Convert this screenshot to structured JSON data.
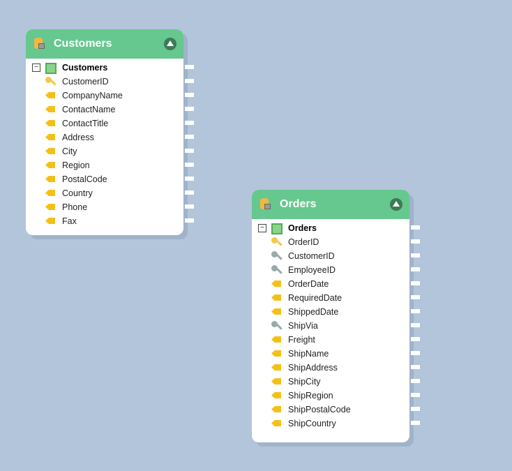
{
  "tables": [
    {
      "title": "Customers",
      "table_row": "Customers",
      "fields": [
        {
          "name": "CustomerID",
          "icon": "primary-key-icon"
        },
        {
          "name": "CompanyName",
          "icon": "attribute-icon"
        },
        {
          "name": "ContactName",
          "icon": "attribute-icon"
        },
        {
          "name": "ContactTitle",
          "icon": "attribute-icon"
        },
        {
          "name": "Address",
          "icon": "attribute-icon"
        },
        {
          "name": "City",
          "icon": "attribute-icon"
        },
        {
          "name": "Region",
          "icon": "attribute-icon"
        },
        {
          "name": "PostalCode",
          "icon": "attribute-icon"
        },
        {
          "name": "Country",
          "icon": "attribute-icon"
        },
        {
          "name": "Phone",
          "icon": "attribute-icon"
        },
        {
          "name": "Fax",
          "icon": "attribute-icon"
        }
      ]
    },
    {
      "title": "Orders",
      "table_row": "Orders",
      "fields": [
        {
          "name": "OrderID",
          "icon": "primary-key-icon"
        },
        {
          "name": "CustomerID",
          "icon": "foreign-key-icon"
        },
        {
          "name": "EmployeeID",
          "icon": "foreign-key-icon"
        },
        {
          "name": "OrderDate",
          "icon": "attribute-icon"
        },
        {
          "name": "RequiredDate",
          "icon": "attribute-icon"
        },
        {
          "name": "ShippedDate",
          "icon": "attribute-icon"
        },
        {
          "name": "ShipVia",
          "icon": "foreign-key-icon"
        },
        {
          "name": "Freight",
          "icon": "attribute-icon"
        },
        {
          "name": "ShipName",
          "icon": "attribute-icon"
        },
        {
          "name": "ShipAddress",
          "icon": "attribute-icon"
        },
        {
          "name": "ShipCity",
          "icon": "attribute-icon"
        },
        {
          "name": "ShipRegion",
          "icon": "attribute-icon"
        },
        {
          "name": "ShipPostalCode",
          "icon": "attribute-icon"
        },
        {
          "name": "ShipCountry",
          "icon": "attribute-icon"
        }
      ]
    }
  ],
  "colors": {
    "header": "#66c78f",
    "background": "#b3c5da"
  }
}
